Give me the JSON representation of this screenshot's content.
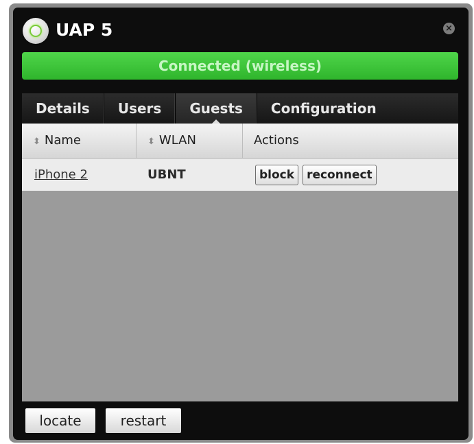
{
  "window": {
    "title": "UAP 5",
    "close_icon": "close-icon"
  },
  "status": {
    "text": "Connected (wireless)",
    "color": "#3cc43a"
  },
  "tabs": [
    {
      "label": "Details",
      "active": false
    },
    {
      "label": "Users",
      "active": false
    },
    {
      "label": "Guests",
      "active": true
    },
    {
      "label": "Configuration",
      "active": false
    }
  ],
  "table": {
    "columns": [
      {
        "label": "Name",
        "sortable": true
      },
      {
        "label": "WLAN",
        "sortable": true
      },
      {
        "label": "Actions",
        "sortable": false
      }
    ],
    "rows": [
      {
        "name": "iPhone 2",
        "wlan": "UBNT",
        "actions": [
          "block",
          "reconnect"
        ]
      }
    ]
  },
  "footer": {
    "locate_label": "locate",
    "restart_label": "restart"
  }
}
